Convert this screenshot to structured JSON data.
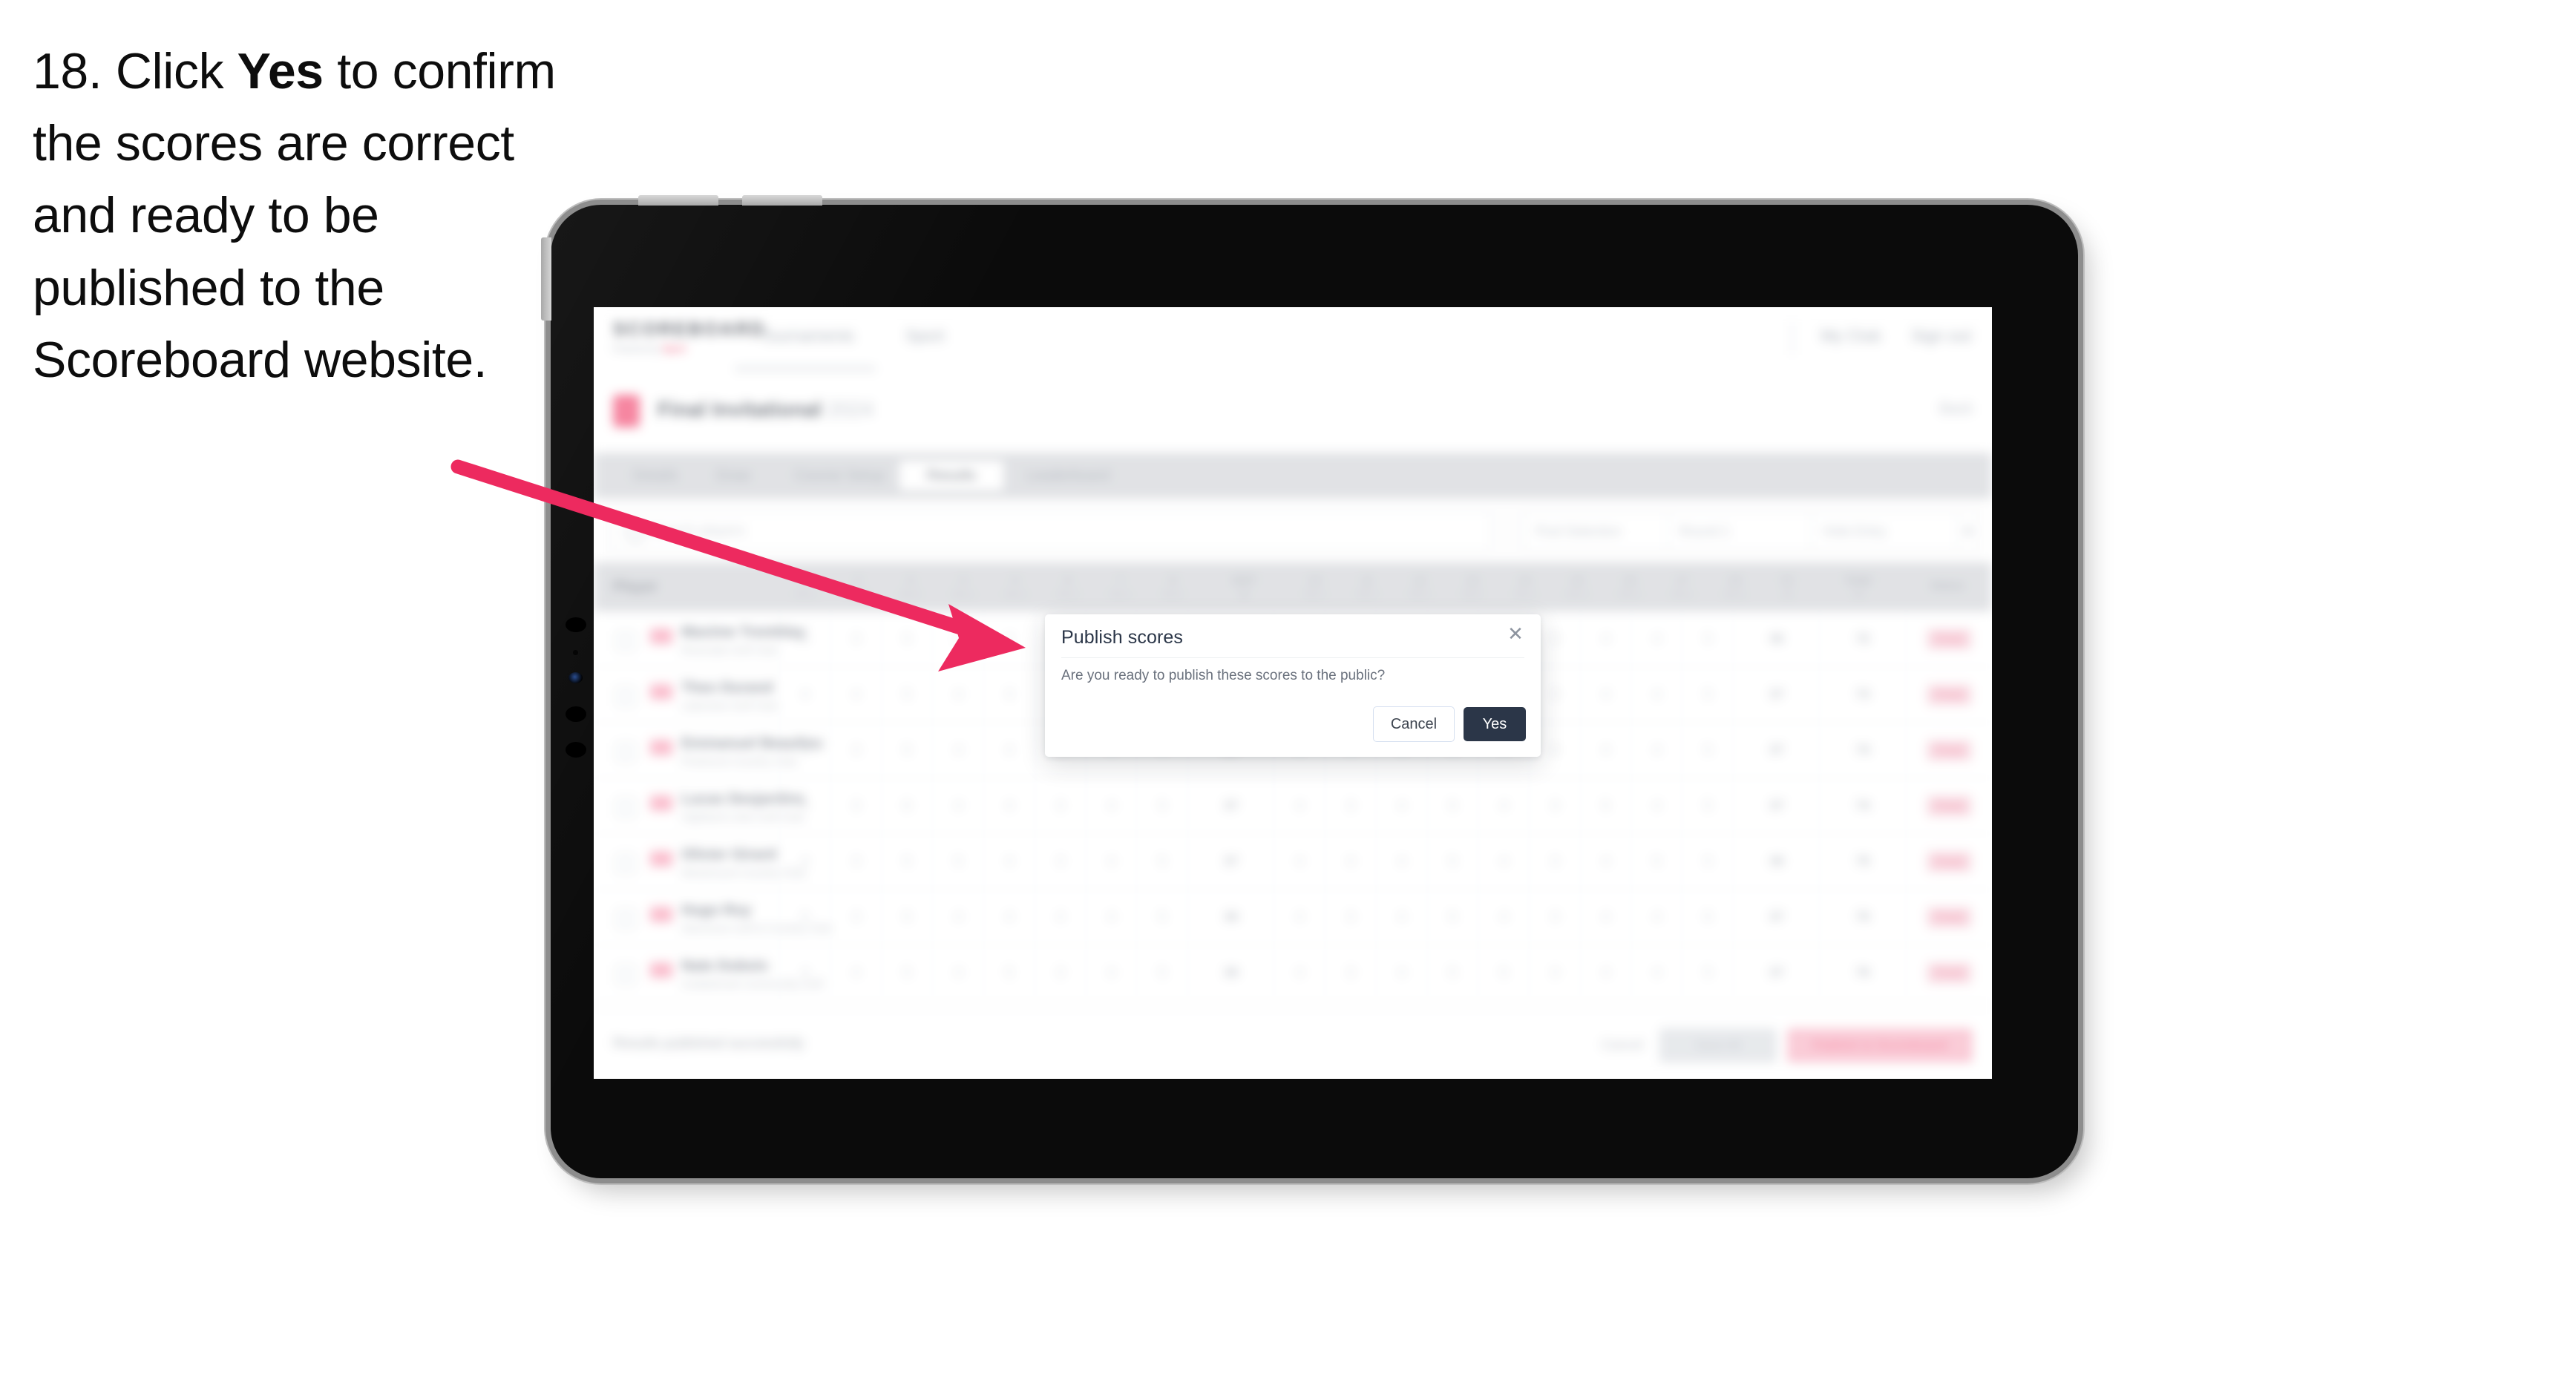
{
  "caption": {
    "step_number": "18.",
    "lead": "Click",
    "bold_word": "Yes",
    "rest": "to confirm the scores are correct and ready to be published to the Scoreboard website.",
    "full_text": "18. Click Yes to confirm the scores are correct and ready to be published to the Scoreboard website."
  },
  "annotation": {
    "arrow_color": "#ED2A5F",
    "points_to": "publish-scores-dialog"
  },
  "device": {
    "type": "tablet",
    "frame_color": "#0b0b0b",
    "bezel_color": "#bdbdbd",
    "hardware_buttons": [
      "volume-up",
      "volume-down",
      "side-switch"
    ]
  },
  "app": {
    "brand": {
      "name": "SCOREBOARD",
      "subtitle": "Powered by",
      "subtitle_accent": "Sport",
      "accent_color": "#EF3B62"
    },
    "topnav": [
      {
        "label": "Tournaments"
      },
      {
        "label": "Sport"
      },
      {
        "label": "My Club"
      },
      {
        "label": "Sign out"
      }
    ],
    "event": {
      "title": "Final Invitational",
      "title_light": "2024",
      "right_label": "Back"
    },
    "tabs": [
      {
        "label": "Details",
        "active": false
      },
      {
        "label": "Draw",
        "active": false
      },
      {
        "label": "Course Setup",
        "active": false
      },
      {
        "label": "Results",
        "active": true
      },
      {
        "label": "Leaderboard",
        "active": false
      }
    ],
    "filters": {
      "search_placeholder": "Search players",
      "controls": [
        {
          "label": "Pool Selection"
        },
        {
          "label": "Round 1"
        },
        {
          "label": "Hole Entry"
        },
        {
          "label": "⚙"
        }
      ]
    },
    "table": {
      "player_header": "Player",
      "hole_headers": [
        {
          "num": "1",
          "par": "Par 4"
        },
        {
          "num": "2",
          "par": "Par 3"
        },
        {
          "num": "3",
          "par": "Par 5"
        },
        {
          "num": "4",
          "par": "Par 4"
        },
        {
          "num": "5",
          "par": "Par 4"
        },
        {
          "num": "6",
          "par": "Par 3"
        },
        {
          "num": "7",
          "par": "Par 4"
        },
        {
          "num": "8",
          "par": "Par 5"
        },
        {
          "num": "OUT",
          "par": "36"
        },
        {
          "num": "10",
          "par": "Par 4"
        },
        {
          "num": "11",
          "par": "Par 3"
        },
        {
          "num": "12",
          "par": "Par 4"
        },
        {
          "num": "13",
          "par": "Par 5"
        },
        {
          "num": "14",
          "par": "Par 4"
        },
        {
          "num": "15",
          "par": "Par 3"
        },
        {
          "num": "16",
          "par": "Par 4"
        },
        {
          "num": "17",
          "par": "Par 4"
        },
        {
          "num": "18",
          "par": "Par 5"
        },
        {
          "num": "IN",
          "par": "36"
        },
        {
          "num": "Total",
          "par": "72"
        },
        {
          "num": "Status",
          "par": ""
        }
      ],
      "rows": [
        {
          "name": "Maxime Tremblay",
          "club": "Riverside Golf Club",
          "scores": [
            "4",
            "3",
            "5",
            "4",
            "4",
            "3",
            "4",
            "5",
            "36",
            "4",
            "3",
            "4",
            "5",
            "4",
            "3",
            "4",
            "4",
            "5",
            "36"
          ],
          "total": "72",
          "status": "Final"
        },
        {
          "name": "Theo Durand",
          "club": "Lakeview Golf Club",
          "scores": [
            "4",
            "4",
            "5",
            "4",
            "3",
            "3",
            "4",
            "5",
            "36",
            "4",
            "3",
            "5",
            "5",
            "4",
            "3",
            "4",
            "4",
            "5",
            "37"
          ],
          "total": "73",
          "status": "Final"
        },
        {
          "name": "Emmanuel Beaulieu",
          "club": "Pinehurst Country Club",
          "scores": [
            "5",
            "3",
            "5",
            "4",
            "4",
            "3",
            "4",
            "5",
            "37",
            "4",
            "3",
            "4",
            "5",
            "4",
            "4",
            "4",
            "4",
            "5",
            "37"
          ],
          "total": "74",
          "status": "Final"
        },
        {
          "name": "Lucas Desjardins",
          "club": "Highland Links Golf Club",
          "scores": [
            "4",
            "3",
            "6",
            "4",
            "4",
            "3",
            "4",
            "5",
            "37",
            "4",
            "3",
            "4",
            "5",
            "4",
            "3",
            "5",
            "4",
            "5",
            "37"
          ],
          "total": "74",
          "status": "Final"
        },
        {
          "name": "Olivier Girard",
          "club": "Westmount Country Club",
          "scores": [
            "4",
            "3",
            "5",
            "5",
            "4",
            "3",
            "4",
            "5",
            "37",
            "4",
            "4",
            "4",
            "5",
            "4",
            "3",
            "4",
            "5",
            "5",
            "38"
          ],
          "total": "75",
          "status": "Final"
        },
        {
          "name": "Hugo Roy",
          "club": "Glenmore Golf & Country Club",
          "scores": [
            "5",
            "3",
            "5",
            "4",
            "4",
            "4",
            "4",
            "5",
            "38",
            "4",
            "3",
            "4",
            "5",
            "4",
            "3",
            "4",
            "4",
            "6",
            "37"
          ],
          "total": "75",
          "status": "Final"
        },
        {
          "name": "Nate Dubois",
          "club": "Cedarbrook Community Golf",
          "scores": [
            "4",
            "4",
            "5",
            "4",
            "5",
            "3",
            "4",
            "5",
            "38",
            "4",
            "3",
            "4",
            "5",
            "5",
            "3",
            "4",
            "4",
            "5",
            "37"
          ],
          "total": "76",
          "status": "Final"
        }
      ]
    },
    "action_bar": {
      "note": "Results published successfully",
      "link": "Cancel",
      "secondary": "Save All",
      "primary": "Publish to Scoreboard"
    }
  },
  "dialog": {
    "title": "Publish scores",
    "close_icon": "✕",
    "message": "Are you ready to publish these scores to the public?",
    "cancel_label": "Cancel",
    "confirm_label": "Yes",
    "confirm_bg": "#2B3648"
  }
}
